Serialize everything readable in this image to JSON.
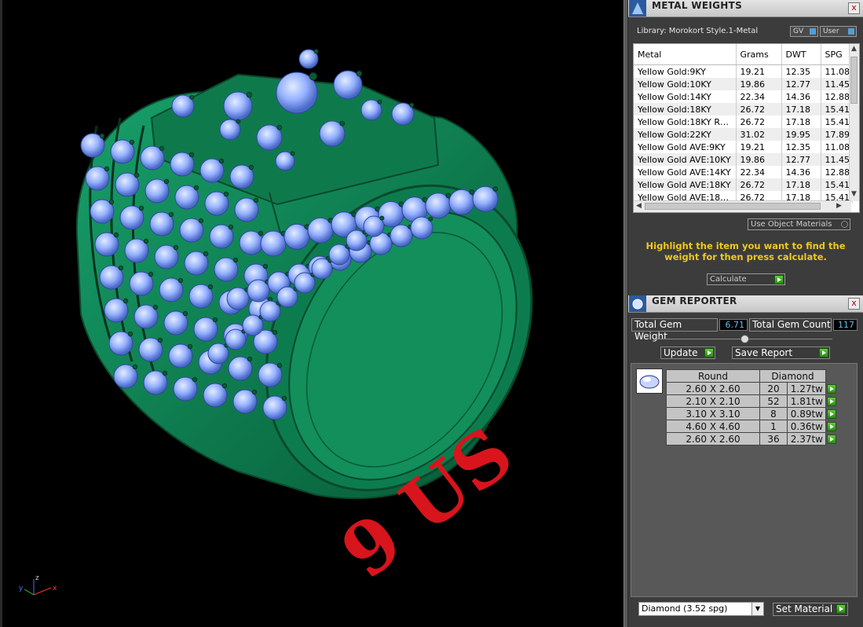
{
  "viewport": {
    "size_label": "9 US",
    "axis": {
      "x": "x",
      "y": "y",
      "z": "z"
    }
  },
  "metal_weights": {
    "title": "METAL WEIGHTS",
    "close": "x",
    "library": "Library: Morokort Style.1-Metal",
    "gv_label": "GV",
    "user_label": "User",
    "columns": [
      "Metal",
      "Grams",
      "DWT",
      "SPG"
    ],
    "rows": [
      [
        "Yellow Gold:9KY",
        "19.21",
        "12.35",
        "11.08"
      ],
      [
        "Yellow Gold:10KY",
        "19.86",
        "12.77",
        "11.45"
      ],
      [
        "Yellow Gold:14KY",
        "22.34",
        "14.36",
        "12.88"
      ],
      [
        "Yellow Gold:18KY",
        "26.72",
        "17.18",
        "15.41"
      ],
      [
        "Yellow Gold:18KY R…",
        "26.72",
        "17.18",
        "15.41"
      ],
      [
        "Yellow Gold:22KY",
        "31.02",
        "19.95",
        "17.89"
      ],
      [
        "Yellow Gold AVE:9KY",
        "19.21",
        "12.35",
        "11.08"
      ],
      [
        "Yellow Gold AVE:10KY",
        "19.86",
        "12.77",
        "11.45"
      ],
      [
        "Yellow Gold AVE:14KY",
        "22.34",
        "14.36",
        "12.88"
      ],
      [
        "Yellow Gold AVE:18KY",
        "26.72",
        "17.18",
        "15.41"
      ],
      [
        "Yellow Gold AVE:18…",
        "26.72",
        "17.18",
        "15.41"
      ]
    ],
    "use_object_materials": "Use Object Materials",
    "hint": "Highlight the item you want to find the weight for then press calculate.",
    "calculate": "Calculate"
  },
  "gem_reporter": {
    "title": "GEM REPORTER",
    "close": "x",
    "total_weight_label": "Total Gem Weight",
    "total_weight": "6.71",
    "total_count_label": "Total Gem Count",
    "total_count": "117",
    "update": "Update",
    "save_report": "Save Report",
    "shape": "Round",
    "stone": "Diamond",
    "rows": [
      [
        "2.60 X 2.60",
        "20",
        "1.27tw"
      ],
      [
        "2.10 X 2.10",
        "52",
        "1.81tw"
      ],
      [
        "3.10 X 3.10",
        "8",
        "0.89tw"
      ],
      [
        "4.60 X 4.60",
        "1",
        "0.36tw"
      ],
      [
        "2.60 X 2.60",
        "36",
        "2.37tw"
      ]
    ],
    "material_select": "Diamond     (3.52 spg)",
    "set_material": "Set Material"
  },
  "colors": {
    "ring": "#0f7a4e",
    "gem": "#9ab6ff",
    "label": "#d8141c",
    "hint": "#f0c820",
    "value": "#5cc0f0"
  }
}
